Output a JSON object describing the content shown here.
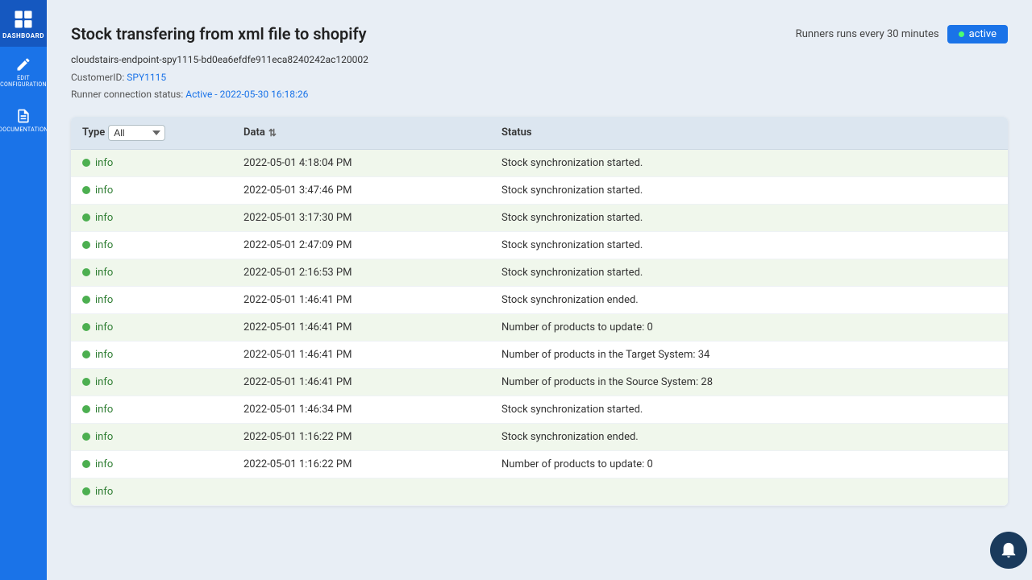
{
  "sidebar": {
    "logo_label": "DASHBOARD",
    "items": [
      {
        "id": "edit-config",
        "icon": "edit-icon",
        "label": "EDIT\nCONFIGURATION"
      },
      {
        "id": "documentation",
        "icon": "doc-icon",
        "label": "DOCUMENTATION"
      }
    ]
  },
  "header": {
    "title": "Stock transfering from xml file to shopify",
    "runner_text": "Runners runs every 30 minutes",
    "active_label": "active",
    "endpoint": "cloudstairs-endpoint-spy1115-bd0ea6efdfe911eca8240242ac120002",
    "customer_id_label": "CustomerID:",
    "customer_id_value": "SPY1115",
    "runner_connection_label": "Runner connection status:",
    "runner_connection_value": "Active - 2022-05-30 16:18:26"
  },
  "table": {
    "columns": [
      {
        "id": "type",
        "label": "Type"
      },
      {
        "id": "data",
        "label": "Data"
      },
      {
        "id": "status",
        "label": "Status"
      }
    ],
    "filter": {
      "options": [
        "All"
      ],
      "selected": "All"
    },
    "rows": [
      {
        "type": "info",
        "data": "2022-05-01 4:18:04 PM",
        "status": "Stock synchronization started."
      },
      {
        "type": "info",
        "data": "2022-05-01 3:47:46 PM",
        "status": "Stock synchronization started."
      },
      {
        "type": "info",
        "data": "2022-05-01 3:17:30 PM",
        "status": "Stock synchronization started."
      },
      {
        "type": "info",
        "data": "2022-05-01 2:47:09 PM",
        "status": "Stock synchronization started."
      },
      {
        "type": "info",
        "data": "2022-05-01 2:16:53 PM",
        "status": "Stock synchronization started."
      },
      {
        "type": "info",
        "data": "2022-05-01 1:46:41 PM",
        "status": "Stock synchronization ended."
      },
      {
        "type": "info",
        "data": "2022-05-01 1:46:41 PM",
        "status": "Number of products to update: 0"
      },
      {
        "type": "info",
        "data": "2022-05-01 1:46:41 PM",
        "status": "Number of products in the Target System: 34"
      },
      {
        "type": "info",
        "data": "2022-05-01 1:46:41 PM",
        "status": "Number of products in the Source System: 28"
      },
      {
        "type": "info",
        "data": "2022-05-01 1:46:34 PM",
        "status": "Stock synchronization started."
      },
      {
        "type": "info",
        "data": "2022-05-01 1:16:22 PM",
        "status": "Stock synchronization ended."
      },
      {
        "type": "info",
        "data": "2022-05-01 1:16:22 PM",
        "status": "Number of products to update: 0"
      },
      {
        "type": "info",
        "data": "",
        "status": ""
      }
    ]
  }
}
